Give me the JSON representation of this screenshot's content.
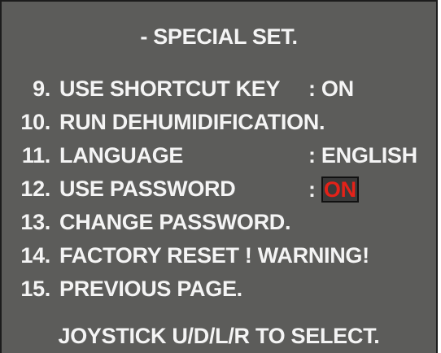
{
  "osd": {
    "title": "- SPECIAL SET.",
    "footer": "JOYSTICK U/D/L/R TO SELECT.",
    "highlight_color": "#e42219",
    "items": [
      {
        "num": "9.",
        "label": "USE SHORTCUT KEY",
        "sep": ":",
        "value": "ON"
      },
      {
        "num": "10.",
        "label": "RUN DEHUMIDIFICATION."
      },
      {
        "num": "11.",
        "label": "LANGUAGE",
        "sep": ":",
        "value": "ENGLISH"
      },
      {
        "num": "12.",
        "label": "USE PASSWORD",
        "sep": ":",
        "value": "ON",
        "selected": true
      },
      {
        "num": "13.",
        "label": "CHANGE PASSWORD."
      },
      {
        "num": "14.",
        "label": "FACTORY RESET ! WARNING!"
      },
      {
        "num": "15.",
        "label": "PREVIOUS PAGE."
      }
    ]
  }
}
